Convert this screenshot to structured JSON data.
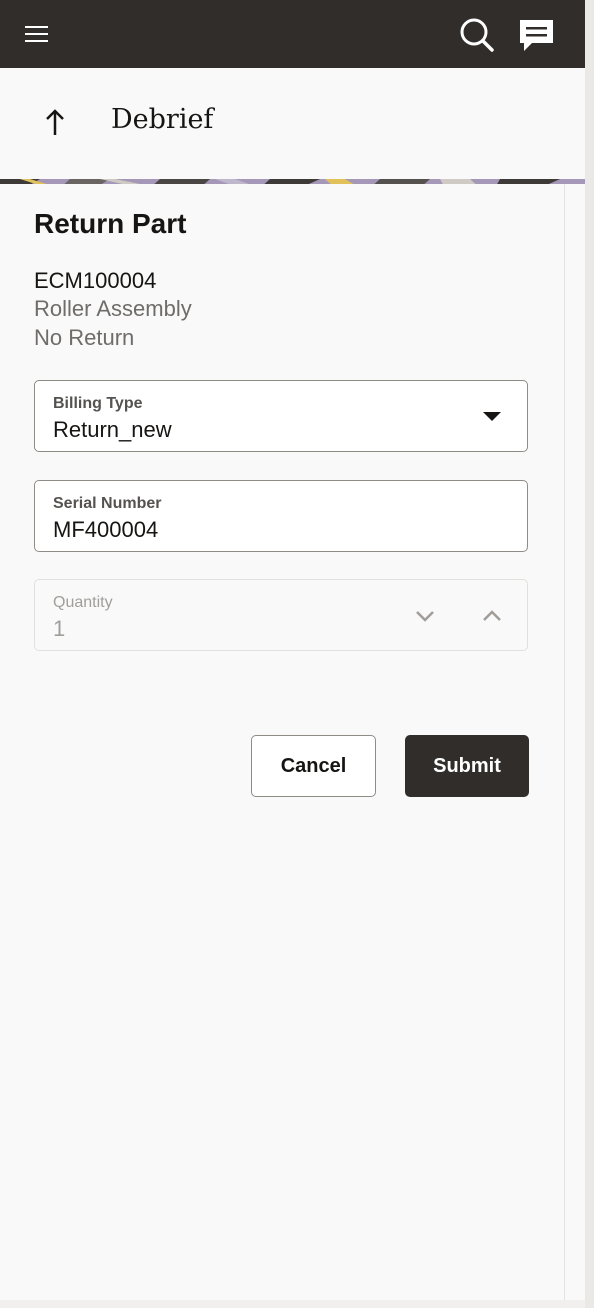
{
  "topbar": {
    "menu_icon": "hamburger-menu-icon",
    "search_icon": "search-icon",
    "chat_icon": "chat-icon"
  },
  "header": {
    "back_icon": "arrow-up-icon",
    "title": "Debrief"
  },
  "return_part": {
    "title": "Return Part",
    "part_id": "ECM100004",
    "part_description": "Roller Assembly",
    "return_status": "No Return"
  },
  "form": {
    "billing_type": {
      "label": "Billing Type",
      "value": "Return_new"
    },
    "serial_number": {
      "label": "Serial Number",
      "value": "MF400004"
    },
    "quantity": {
      "label": "Quantity",
      "value": "1",
      "disabled": true
    }
  },
  "actions": {
    "cancel_label": "Cancel",
    "submit_label": "Submit"
  },
  "colors": {
    "topbar_bg": "#312d2a",
    "page_bg": "#f9f9f9",
    "primary_button": "#312d2a",
    "text": "#161513",
    "secondary_text": "#6f6c69"
  }
}
